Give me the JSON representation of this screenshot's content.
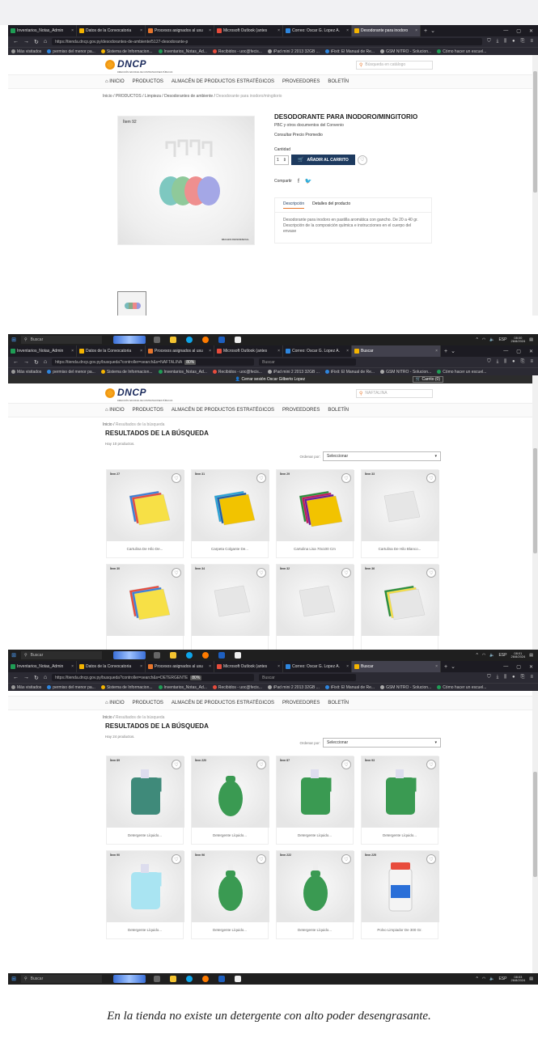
{
  "tabs": [
    {
      "label": "Inventarios_Notas_Admin",
      "color": "#1f9d55"
    },
    {
      "label": "Datos de la Convocatoria",
      "color": "#f4b400"
    },
    {
      "label": "Procesos asignados al usu",
      "color": "#e8762c"
    },
    {
      "label": "Microsoft Outlook (antes",
      "color": "#e74c3c"
    },
    {
      "label": "Correo: Oscar G. Lopez A.",
      "color": "#2e86de"
    }
  ],
  "bookmarks": [
    "Más visitados",
    "permiso del menor pa...",
    "Sistema de Informacion...",
    "Inventarios_Notas_Ad...",
    "Recibidos - uoc@fecis...",
    "iPad mini 2 2013 32GB ...",
    "iFixit: El Manual de Re...",
    "GSM NITRO - Solucion...",
    "Cómo hacer un escuel..."
  ],
  "browser": {
    "zoom": "80%",
    "search_placeholder": "Buscar"
  },
  "site": {
    "logo": "DNCP",
    "logo_sub": "DIRECCIÓN NACIONAL DE CONTRATACIONES PÚBLICAS",
    "nav": [
      "INICIO",
      "PRODUCTOS",
      "ALMACÉN DE PRODUCTOS ESTRATÉGICOS",
      "PROVEEDORES",
      "BOLETÍN"
    ]
  },
  "panel1": {
    "tab_active": "Desodorante para inodoro",
    "url": "https://tienda.dncp.gov.py/desodorantes-de-ambiente/5127-desodorante-p",
    "search_placeholder": "Búsqueda en catálogo",
    "breadcrumb": [
      "Inicio",
      "PRODUCTOS",
      "Limpieza",
      "Desodorantes de ambiente",
      "Desodorante para inodoro/mingitorio"
    ],
    "item": "Ítem 92",
    "ref": "IMAGEN REFERENCIAL",
    "title": "DESODORANTE PARA INODORO/MINGITORIO",
    "pbc": "PBC y otros documentos del Convenio",
    "price": "Consultar Precio Promedio",
    "qty_label": "Cantidad",
    "qty": "1",
    "cart_button": "AÑADIR AL CARRITO",
    "share": "Compartir",
    "tab_desc": "Descripción",
    "tab_details": "Detalles del producto",
    "description": "Desodorante para inodoro en pastilla aromática con gancho. De 20 a 40 gr. Descripción de la composición química e instrucciones en el cuerpo del envase",
    "time": "08:00",
    "date": "26/8/2024"
  },
  "panel2": {
    "tab_active": "Buscar",
    "url": "https://tienda.dncp.gov.py/busqueda?controller=search&s=NAFTALINA",
    "user": "Cerrar sesión Oscar Gilberto Lopez",
    "cart": "Carrito (0)",
    "search_value": "NAFTALINA",
    "breadcrumb": [
      "Inicio",
      "Resultados de la búsqueda"
    ],
    "title": "RESULTADOS DE LA BÚSQUEDA",
    "count": "Hay 10 productos.",
    "sort_label": "Ordenar por:",
    "sort_value": "Seleccionar",
    "products": [
      {
        "item": "Ítem 27",
        "name": "Cartulina De Hilo De..."
      },
      {
        "item": "Ítem 31",
        "name": "Carpeta Colgante De..."
      },
      {
        "item": "Ítem 29",
        "name": "Cartulina Lisa 70x100 Cm"
      },
      {
        "item": "Ítem 33",
        "name": "Cartulina De Hilo Blanco..."
      },
      {
        "item": "Ítem 30",
        "name": ""
      },
      {
        "item": "Ítem 34",
        "name": ""
      },
      {
        "item": "Ítem 32",
        "name": ""
      },
      {
        "item": "Ítem 36",
        "name": ""
      }
    ],
    "time": "08:01",
    "date": "26/8/2024"
  },
  "panel3": {
    "tab_active": "Buscar",
    "url": "https://tienda.dncp.gov.py/busqueda?controller=search&s=DETERGENTE",
    "breadcrumb": [
      "Inicio",
      "Resultados de la búsqueda"
    ],
    "title": "RESULTADOS DE LA BÚSQUEDA",
    "count": "Hay 24 productos.",
    "sort_label": "Ordenar por:",
    "sort_value": "Seleccionar",
    "products": [
      {
        "item": "Ítem 89",
        "name": "Detergente Líquido..."
      },
      {
        "item": "Ítem 220",
        "name": "Detergente Líquido..."
      },
      {
        "item": "Ítem 87",
        "name": "Detergente Líquido..."
      },
      {
        "item": "Ítem 93",
        "name": "Detergente Líquido..."
      },
      {
        "item": "Ítem 90",
        "name": "Detergente Líquido..."
      },
      {
        "item": "Ítem 96",
        "name": "Detergente Líquido..."
      },
      {
        "item": "Ítem 222",
        "name": "Detergente Líquido..."
      },
      {
        "item": "Ítem 225",
        "name": "Polvo Limpiador De 300 Gr."
      }
    ],
    "time": "08:03",
    "date": "26/8/2024"
  },
  "taskbar": {
    "search": "Buscar",
    "lang": "ESP"
  },
  "caption": "En la tienda no existe un detergente con alto poder desengrasante."
}
